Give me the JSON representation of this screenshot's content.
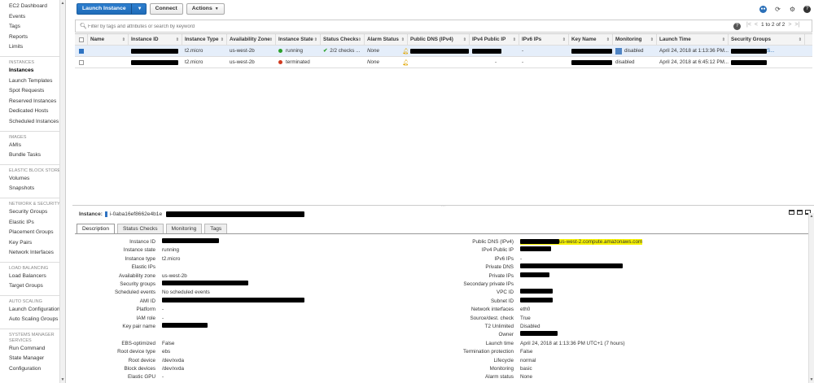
{
  "sidebar": {
    "items": [
      {
        "label": "EC2 Dashboard",
        "type": "item"
      },
      {
        "label": "Events",
        "type": "item"
      },
      {
        "label": "Tags",
        "type": "item"
      },
      {
        "label": "Reports",
        "type": "item"
      },
      {
        "label": "Limits",
        "type": "item"
      },
      {
        "label": "INSTANCES",
        "type": "section"
      },
      {
        "label": "Instances",
        "type": "item",
        "active": true
      },
      {
        "label": "Launch Templates",
        "type": "item"
      },
      {
        "label": "Spot Requests",
        "type": "item"
      },
      {
        "label": "Reserved Instances",
        "type": "item"
      },
      {
        "label": "Dedicated Hosts",
        "type": "item"
      },
      {
        "label": "Scheduled Instances",
        "type": "item"
      },
      {
        "label": "IMAGES",
        "type": "section"
      },
      {
        "label": "AMIs",
        "type": "item"
      },
      {
        "label": "Bundle Tasks",
        "type": "item"
      },
      {
        "label": "ELASTIC BLOCK STORE",
        "type": "section"
      },
      {
        "label": "Volumes",
        "type": "item"
      },
      {
        "label": "Snapshots",
        "type": "item"
      },
      {
        "label": "NETWORK & SECURITY",
        "type": "section"
      },
      {
        "label": "Security Groups",
        "type": "item"
      },
      {
        "label": "Elastic IPs",
        "type": "item"
      },
      {
        "label": "Placement Groups",
        "type": "item"
      },
      {
        "label": "Key Pairs",
        "type": "item"
      },
      {
        "label": "Network Interfaces",
        "type": "item"
      },
      {
        "label": "LOAD BALANCING",
        "type": "section"
      },
      {
        "label": "Load Balancers",
        "type": "item"
      },
      {
        "label": "Target Groups",
        "type": "item"
      },
      {
        "label": "AUTO SCALING",
        "type": "section"
      },
      {
        "label": "Launch Configurations",
        "type": "item",
        "wrap": true
      },
      {
        "label": "Auto Scaling Groups",
        "type": "item"
      },
      {
        "label": "SYSTEMS MANAGER SERVICES",
        "type": "section"
      },
      {
        "label": "Run Command",
        "type": "item"
      },
      {
        "label": "State Manager",
        "type": "item"
      },
      {
        "label": "Configuration",
        "type": "item"
      }
    ]
  },
  "toolbar": {
    "launch_label": "Launch Instance",
    "connect_label": "Connect",
    "actions_label": "Actions"
  },
  "filter": {
    "placeholder": "Filter by tags and attributes or search by keyword",
    "pager_text": "1 to 2 of 2"
  },
  "table": {
    "headers": [
      "Name",
      "Instance ID",
      "Instance Type",
      "Availability Zone",
      "Instance State",
      "Status Checks",
      "Alarm Status",
      "Public DNS (IPv4)",
      "IPv4 Public IP",
      "IPv6 IPs",
      "Key Name",
      "Monitoring",
      "Launch Time",
      "Security Groups"
    ],
    "rows": [
      {
        "type": "t2.micro",
        "zone": "us-west-2b",
        "state": "running",
        "checks": "2/2 checks ...",
        "alarm": "None",
        "ipv6": "-",
        "monitoring": "disabled",
        "launch": "April 24, 2018 at 1:13:36 PM...",
        "sg_suffix": "S..."
      },
      {
        "type": "t2.micro",
        "zone": "us-west-2b",
        "state": "terminated",
        "checks": "",
        "alarm": "None",
        "ipv4": "-",
        "ipv6": "-",
        "monitoring": "disabled",
        "launch": "April 24, 2018 at 6:45:12 PM..."
      }
    ]
  },
  "detail": {
    "title_label": "Instance:",
    "instance_id": "i-0aba16ef8662e4b1e",
    "tabs": [
      "Description",
      "Status Checks",
      "Monitoring",
      "Tags"
    ],
    "left": {
      "labels": [
        "Instance ID",
        "Instance state",
        "Instance type",
        "Elastic IPs",
        "Availability zone",
        "Security groups",
        "Scheduled events",
        "AMI ID",
        "Platform",
        "IAM role",
        "Key pair name",
        "",
        "EBS-optimized",
        "Root device type",
        "Root device",
        "Block devices",
        "Elastic GPU"
      ],
      "values": {
        "state": "running",
        "type": "t2.micro",
        "zone": "us-west-2b",
        "events": "No scheduled events",
        "platform": "-",
        "iam": "-",
        "ebs": "False",
        "root_type": "ebs",
        "root_device": "/dev/xvda",
        "block": "/dev/xvda",
        "gpu": "-"
      }
    },
    "right": {
      "labels": [
        "Public DNS (IPv4)",
        "IPv4 Public IP",
        "IPv6 IPs",
        "Private DNS",
        "Private IPs",
        "Secondary private IPs",
        "VPC ID",
        "Subnet ID",
        "Network interfaces",
        "Source/dest. check",
        "T2 Unlimited",
        "Owner",
        "Launch time",
        "Termination protection",
        "Lifecycle",
        "Monitoring",
        "Alarm status"
      ],
      "values": {
        "dns_suffix": "us-west-2.compute.amazonaws.com",
        "ipv6": "-",
        "eni": "eth0",
        "srcdst": "True",
        "t2": "Disabled",
        "launch": "April 24, 2018 at 1:13:36 PM UTC+1 (7 hours)",
        "term": "False",
        "lifecycle": "normal",
        "monitoring": "basic",
        "alarm": "None"
      }
    }
  }
}
